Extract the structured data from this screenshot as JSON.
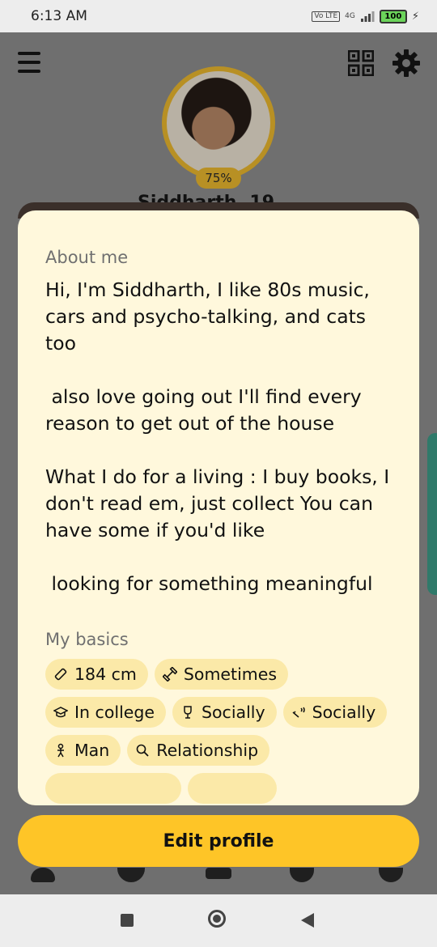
{
  "status_bar": {
    "time": "6:13 AM",
    "volte": "Vo LTE",
    "network": "4G",
    "battery": "100"
  },
  "profile": {
    "completion": "75%",
    "name_partial": "Siddharth, 19"
  },
  "about": {
    "title": "About me",
    "text": "Hi, I'm Siddharth, I like 80s music, cars and psycho-talking, and cats too\n\n also love going out I'll find every reason to get out of the house\n\nWhat I do for a living : I buy books, I don't read em, just collect You can have some if you'd like\n\n looking for something meaningful"
  },
  "basics": {
    "title": "My basics",
    "chips": [
      {
        "icon": "ruler-icon",
        "label": "184 cm"
      },
      {
        "icon": "dumbbell-icon",
        "label": "Sometimes"
      },
      {
        "icon": "graduation-cap-icon",
        "label": "In college"
      },
      {
        "icon": "wine-glass-icon",
        "label": "Socially"
      },
      {
        "icon": "smoking-icon",
        "label": "Socially"
      },
      {
        "icon": "person-icon",
        "label": "Man"
      },
      {
        "icon": "search-icon",
        "label": "Relationship"
      }
    ]
  },
  "actions": {
    "edit_profile": "Edit profile"
  }
}
